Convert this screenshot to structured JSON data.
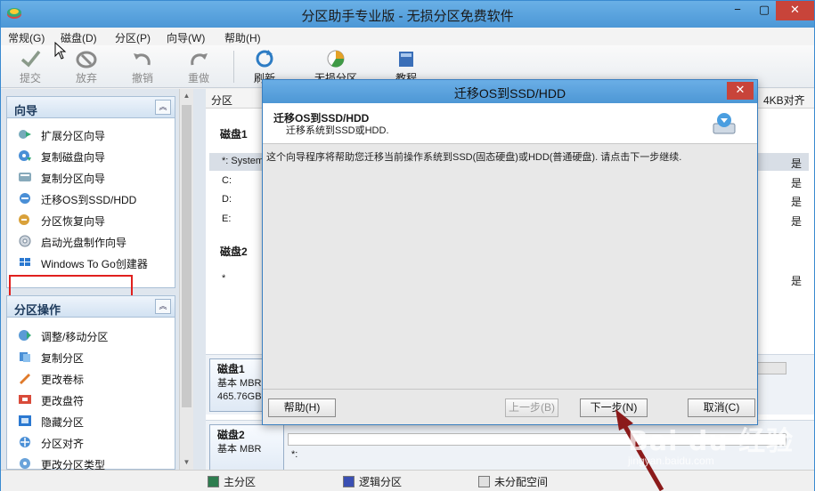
{
  "window": {
    "title": "分区助手专业版 - 无损分区免费软件",
    "controls": {
      "minimize": "−",
      "maximize": "▢",
      "close": "✕"
    }
  },
  "menu": [
    "常规(G)",
    "磁盘(D)",
    "分区(P)",
    "向导(W)",
    "帮助(H)"
  ],
  "toolbar": {
    "submit": "提交",
    "discard": "放弃",
    "undo": "撤销",
    "redo": "重做",
    "refresh": "刷新",
    "lossless": "无损分区",
    "tutorial": "教程"
  },
  "wizard_panel": {
    "title": "向导",
    "collapse": "︽",
    "items": [
      {
        "label": "扩展分区向导",
        "icon": "expand-partition-icon"
      },
      {
        "label": "复制磁盘向导",
        "icon": "copy-disk-icon"
      },
      {
        "label": "复制分区向导",
        "icon": "copy-partition-icon"
      },
      {
        "label": "迁移OS到SSD/HDD",
        "icon": "migrate-os-icon"
      },
      {
        "label": "分区恢复向导",
        "icon": "partition-recovery-icon"
      },
      {
        "label": "启动光盘制作向导",
        "icon": "boot-disc-icon"
      },
      {
        "label": "Windows To Go创建器",
        "icon": "windows-to-go-icon"
      }
    ]
  },
  "ops_panel": {
    "title": "分区操作",
    "collapse": "︽",
    "items": [
      {
        "label": "调整/移动分区",
        "icon": "resize-partition-icon"
      },
      {
        "label": "复制分区",
        "icon": "copy-icon"
      },
      {
        "label": "更改卷标",
        "icon": "label-icon"
      },
      {
        "label": "更改盘符",
        "icon": "drive-letter-icon"
      },
      {
        "label": "隐藏分区",
        "icon": "hide-partition-icon"
      },
      {
        "label": "分区对齐",
        "icon": "align-partition-icon"
      },
      {
        "label": "更改分区类型",
        "icon": "partition-type-icon"
      }
    ]
  },
  "columns": {
    "partition": "分区",
    "align4k": "4KB对齐"
  },
  "disk1": {
    "label": "磁盘1",
    "rows": [
      {
        "name": "*: System",
        "align": "是"
      },
      {
        "name": "C:",
        "align": "是"
      },
      {
        "name": "D:",
        "align": "是"
      },
      {
        "name": "E:",
        "align": "是"
      }
    ]
  },
  "disk2": {
    "label": "磁盘2",
    "rows": [
      {
        "name": "*",
        "align": "是"
      }
    ]
  },
  "diskmap": {
    "disk1": {
      "name": "磁盘1",
      "type": "基本 MBR",
      "size": "465.76GB"
    },
    "disk2": {
      "name": "磁盘2",
      "type": "基本 MBR",
      "partition": "*:"
    }
  },
  "statusbar": {
    "primary": "主分区",
    "logical": "逻辑分区",
    "unallocated": "未分配空间"
  },
  "dialog": {
    "title": "迁移OS到SSD/HDD",
    "close": "✕",
    "header_title": "迁移OS到SSD/HDD",
    "header_subtitle": "迁移系统到SSD或HDD.",
    "body": "这个向导程序将帮助您迁移当前操作系统到SSD(固态硬盘)或HDD(普通硬盘). 请点击下一步继续.",
    "help": "帮助(H)",
    "prev": "上一步(B)",
    "next": "下一步(N)",
    "cancel": "取消(C)"
  },
  "watermark": {
    "logo": "Bai du 经验",
    "url": "jingyan.baidu.com"
  },
  "colors": {
    "titlebar": "#4c97d6",
    "highlight_box": "#e0201e",
    "close_button": "#c8443a",
    "primary_legend": "#2e7d4f",
    "logical_legend": "#3a4fb3",
    "unallocated_legend": "#e0e0e0"
  }
}
